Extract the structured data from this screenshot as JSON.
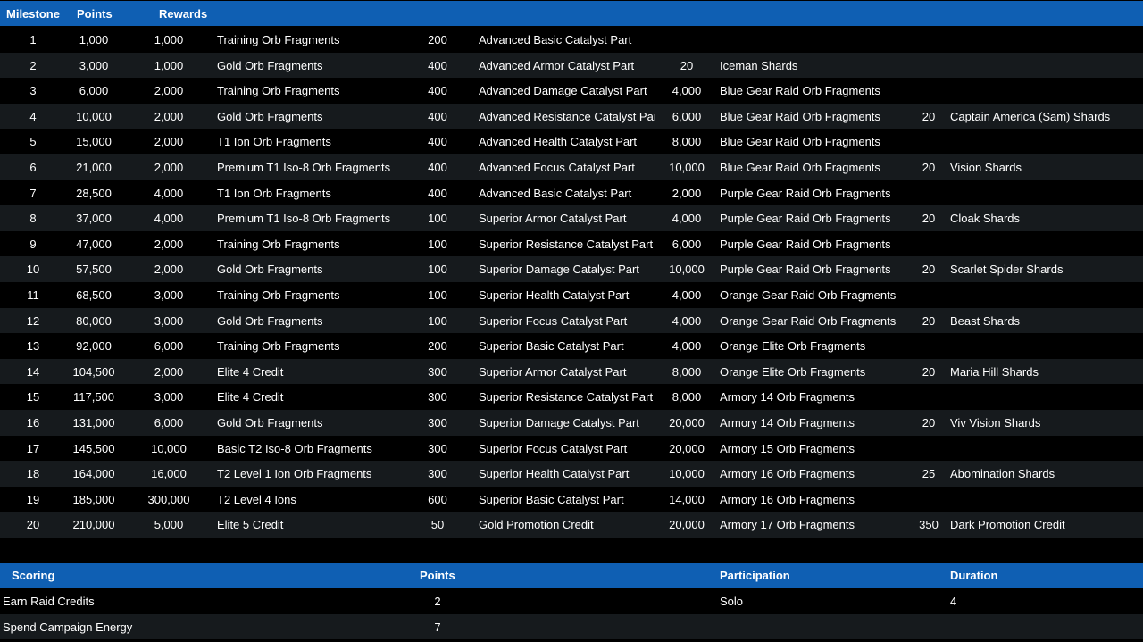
{
  "milestones_header": {
    "milestone": "Milestone",
    "points": "Points",
    "rewards": "Rewards"
  },
  "milestones": [
    {
      "milestone": "1",
      "points": "1,000",
      "rewards": [
        {
          "qty": "1,000",
          "name": "Training Orb Fragments"
        },
        {
          "qty": "200",
          "name": "Advanced Basic Catalyst Part"
        },
        {
          "qty": "",
          "name": ""
        },
        {
          "qty": "",
          "name": ""
        }
      ]
    },
    {
      "milestone": "2",
      "points": "3,000",
      "rewards": [
        {
          "qty": "1,000",
          "name": "Gold Orb Fragments"
        },
        {
          "qty": "400",
          "name": "Advanced Armor Catalyst Part"
        },
        {
          "qty": "20",
          "name": "Iceman Shards"
        },
        {
          "qty": "",
          "name": ""
        }
      ]
    },
    {
      "milestone": "3",
      "points": "6,000",
      "rewards": [
        {
          "qty": "2,000",
          "name": "Training Orb Fragments"
        },
        {
          "qty": "400",
          "name": "Advanced Damage Catalyst Part"
        },
        {
          "qty": "4,000",
          "name": "Blue Gear Raid Orb Fragments"
        },
        {
          "qty": "",
          "name": ""
        }
      ]
    },
    {
      "milestone": "4",
      "points": "10,000",
      "rewards": [
        {
          "qty": "2,000",
          "name": "Gold Orb Fragments"
        },
        {
          "qty": "400",
          "name": "Advanced Resistance Catalyst Part"
        },
        {
          "qty": "6,000",
          "name": "Blue Gear Raid Orb Fragments"
        },
        {
          "qty": "20",
          "name": "Captain America (Sam) Shards"
        }
      ]
    },
    {
      "milestone": "5",
      "points": "15,000",
      "rewards": [
        {
          "qty": "2,000",
          "name": "T1 Ion Orb Fragments"
        },
        {
          "qty": "400",
          "name": "Advanced Health Catalyst Part"
        },
        {
          "qty": "8,000",
          "name": "Blue Gear Raid Orb Fragments"
        },
        {
          "qty": "",
          "name": ""
        }
      ]
    },
    {
      "milestone": "6",
      "points": "21,000",
      "rewards": [
        {
          "qty": "2,000",
          "name": "Premium T1 Iso-8 Orb Fragments"
        },
        {
          "qty": "400",
          "name": "Advanced Focus Catalyst Part"
        },
        {
          "qty": "10,000",
          "name": "Blue Gear Raid Orb Fragments"
        },
        {
          "qty": "20",
          "name": "Vision Shards"
        }
      ]
    },
    {
      "milestone": "7",
      "points": "28,500",
      "rewards": [
        {
          "qty": "4,000",
          "name": "T1 Ion Orb Fragments"
        },
        {
          "qty": "400",
          "name": "Advanced Basic Catalyst Part"
        },
        {
          "qty": "2,000",
          "name": "Purple Gear Raid Orb Fragments"
        },
        {
          "qty": "",
          "name": ""
        }
      ]
    },
    {
      "milestone": "8",
      "points": "37,000",
      "rewards": [
        {
          "qty": "4,000",
          "name": "Premium T1 Iso-8 Orb Fragments"
        },
        {
          "qty": "100",
          "name": "Superior Armor Catalyst Part"
        },
        {
          "qty": "4,000",
          "name": "Purple Gear Raid Orb Fragments"
        },
        {
          "qty": "20",
          "name": "Cloak Shards"
        }
      ]
    },
    {
      "milestone": "9",
      "points": "47,000",
      "rewards": [
        {
          "qty": "2,000",
          "name": "Training Orb Fragments"
        },
        {
          "qty": "100",
          "name": "Superior Resistance Catalyst Part"
        },
        {
          "qty": "6,000",
          "name": "Purple Gear Raid Orb Fragments"
        },
        {
          "qty": "",
          "name": ""
        }
      ]
    },
    {
      "milestone": "10",
      "points": "57,500",
      "rewards": [
        {
          "qty": "2,000",
          "name": "Gold Orb Fragments"
        },
        {
          "qty": "100",
          "name": "Superior Damage Catalyst Part"
        },
        {
          "qty": "10,000",
          "name": "Purple Gear Raid Orb Fragments"
        },
        {
          "qty": "20",
          "name": "Scarlet Spider Shards"
        }
      ]
    },
    {
      "milestone": "11",
      "points": "68,500",
      "rewards": [
        {
          "qty": "3,000",
          "name": "Training Orb Fragments"
        },
        {
          "qty": "100",
          "name": "Superior Health Catalyst Part"
        },
        {
          "qty": "4,000",
          "name": "Orange Gear Raid Orb Fragments"
        },
        {
          "qty": "",
          "name": ""
        }
      ]
    },
    {
      "milestone": "12",
      "points": "80,000",
      "rewards": [
        {
          "qty": "3,000",
          "name": "Gold Orb Fragments"
        },
        {
          "qty": "100",
          "name": "Superior Focus Catalyst Part"
        },
        {
          "qty": "4,000",
          "name": "Orange Gear Raid Orb Fragments"
        },
        {
          "qty": "20",
          "name": "Beast Shards"
        }
      ]
    },
    {
      "milestone": "13",
      "points": "92,000",
      "rewards": [
        {
          "qty": "6,000",
          "name": "Training Orb Fragments"
        },
        {
          "qty": "200",
          "name": "Superior Basic Catalyst Part"
        },
        {
          "qty": "4,000",
          "name": "Orange Elite Orb Fragments"
        },
        {
          "qty": "",
          "name": ""
        }
      ]
    },
    {
      "milestone": "14",
      "points": "104,500",
      "rewards": [
        {
          "qty": "2,000",
          "name": "Elite 4 Credit"
        },
        {
          "qty": "300",
          "name": "Superior Armor Catalyst Part"
        },
        {
          "qty": "8,000",
          "name": "Orange Elite Orb Fragments"
        },
        {
          "qty": "20",
          "name": "Maria Hill Shards"
        }
      ]
    },
    {
      "milestone": "15",
      "points": "117,500",
      "rewards": [
        {
          "qty": "3,000",
          "name": "Elite 4 Credit"
        },
        {
          "qty": "300",
          "name": "Superior Resistance Catalyst Part"
        },
        {
          "qty": "8,000",
          "name": "Armory 14 Orb Fragments"
        },
        {
          "qty": "",
          "name": ""
        }
      ]
    },
    {
      "milestone": "16",
      "points": "131,000",
      "rewards": [
        {
          "qty": "6,000",
          "name": "Gold Orb Fragments"
        },
        {
          "qty": "300",
          "name": "Superior Damage Catalyst Part"
        },
        {
          "qty": "20,000",
          "name": "Armory 14 Orb Fragments"
        },
        {
          "qty": "20",
          "name": "Viv Vision Shards"
        }
      ]
    },
    {
      "milestone": "17",
      "points": "145,500",
      "rewards": [
        {
          "qty": "10,000",
          "name": "Basic T2 Iso-8 Orb Fragments"
        },
        {
          "qty": "300",
          "name": "Superior Focus Catalyst Part"
        },
        {
          "qty": "20,000",
          "name": "Armory 15 Orb Fragments"
        },
        {
          "qty": "",
          "name": ""
        }
      ]
    },
    {
      "milestone": "18",
      "points": "164,000",
      "rewards": [
        {
          "qty": "16,000",
          "name": "T2 Level 1 Ion Orb Fragments"
        },
        {
          "qty": "300",
          "name": "Superior Health Catalyst Part"
        },
        {
          "qty": "10,000",
          "name": "Armory 16 Orb Fragments"
        },
        {
          "qty": "25",
          "name": "Abomination Shards"
        }
      ]
    },
    {
      "milestone": "19",
      "points": "185,000",
      "rewards": [
        {
          "qty": "300,000",
          "name": "T2 Level 4 Ions"
        },
        {
          "qty": "600",
          "name": "Superior Basic Catalyst Part"
        },
        {
          "qty": "14,000",
          "name": "Armory 16 Orb Fragments"
        },
        {
          "qty": "",
          "name": ""
        }
      ]
    },
    {
      "milestone": "20",
      "points": "210,000",
      "rewards": [
        {
          "qty": "5,000",
          "name": "Elite 5 Credit"
        },
        {
          "qty": "50",
          "name": "Gold Promotion Credit"
        },
        {
          "qty": "20,000",
          "name": "Armory 17 Orb Fragments"
        },
        {
          "qty": "350",
          "name": "Dark Promotion Credit"
        }
      ]
    }
  ],
  "scoring_header": {
    "scoring": "Scoring",
    "points": "Points",
    "participation": "Participation",
    "duration": "Duration"
  },
  "scoring": [
    {
      "name": "Earn Raid Credits",
      "points": "2",
      "participation": "Solo",
      "duration": "4"
    },
    {
      "name": "Spend Campaign Energy",
      "points": "7",
      "participation": "",
      "duration": ""
    }
  ],
  "colors": {
    "header_bg": "#0f5fb3",
    "row_even_bg": "#161a1d",
    "row_odd_bg": "#000000",
    "text": "#ffffff"
  }
}
